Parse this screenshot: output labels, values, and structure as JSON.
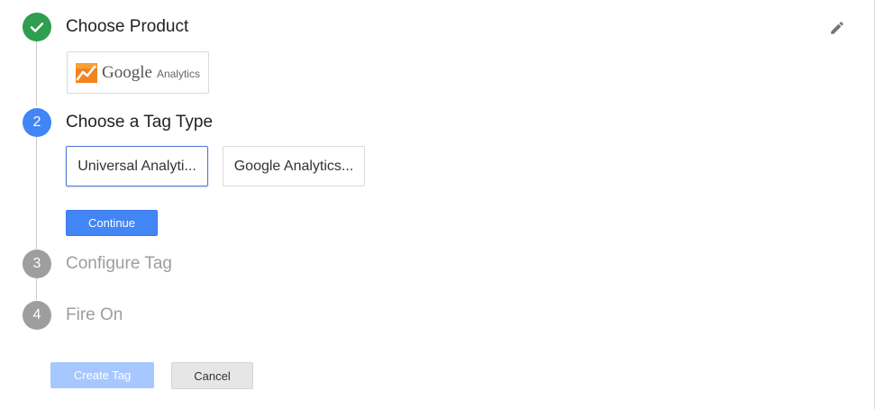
{
  "steps": [
    {
      "number": "",
      "title": "Choose Product",
      "state": "done"
    },
    {
      "number": "2",
      "title": "Choose a Tag Type",
      "state": "active"
    },
    {
      "number": "3",
      "title": "Configure Tag",
      "state": "pending"
    },
    {
      "number": "4",
      "title": "Fire On",
      "state": "pending"
    }
  ],
  "product": {
    "logo_word1": "Google",
    "logo_word2": "Analytics"
  },
  "tag_types": [
    {
      "label": "Universal Analyti...",
      "selected": true
    },
    {
      "label": "Google Analytics...",
      "selected": false
    }
  ],
  "buttons": {
    "continue": "Continue",
    "create_tag": "Create Tag",
    "cancel": "Cancel"
  },
  "icons": {
    "step1": "check-icon",
    "edit": "pencil-icon",
    "product": "google-analytics-logo"
  },
  "colors": {
    "done": "#2e9e4f",
    "active": "#4285f4",
    "pending": "#9e9e9e",
    "primary_button": "#4285f4",
    "disabled_button": "#a6c8ff"
  }
}
